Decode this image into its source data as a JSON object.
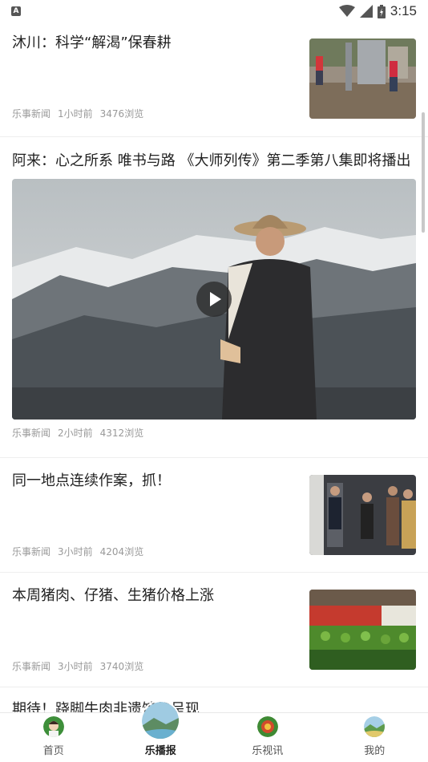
{
  "status_bar": {
    "time": "3:15",
    "notification_letter": "A"
  },
  "feed": {
    "items": [
      {
        "title": "沐川：科学“解渴”保春耕",
        "source": "乐事新闻",
        "time": "1小时前",
        "views": "3476浏览"
      },
      {
        "title": "阿来：心之所系 唯书与路 《大师列传》第二季第八集即将播出",
        "source": "乐事新闻",
        "time": "2小时前",
        "views": "4312浏览"
      },
      {
        "title": "同一地点连续作案，抓！",
        "source": "乐事新闻",
        "time": "3小时前",
        "views": "4204浏览"
      },
      {
        "title": "本周猪肉、仔猪、生猪价格上涨",
        "source": "乐事新闻",
        "time": "3小时前",
        "views": "3740浏览"
      },
      {
        "title": "期待！跷脚牛肉非遗馆将呈现"
      }
    ]
  },
  "bottom_nav": {
    "items": [
      {
        "label": "首页"
      },
      {
        "label": "乐播报"
      },
      {
        "label": "乐视讯"
      },
      {
        "label": "我的"
      }
    ],
    "active_index": 1
  },
  "colors": {
    "text": "#222222",
    "meta": "#999999",
    "divider": "#eeeeee"
  }
}
